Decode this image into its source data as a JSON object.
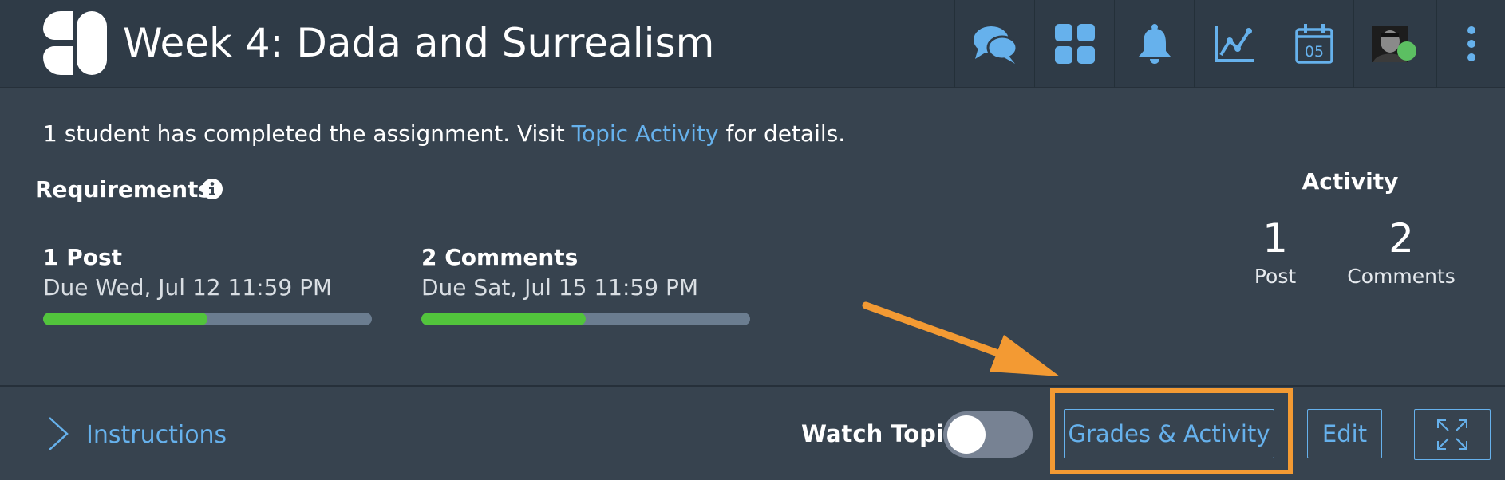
{
  "header": {
    "title": "Week 4: Dada and Surrealism",
    "logo_icon": "app-logo-icon",
    "nav": [
      {
        "name": "discussions-button",
        "icon": "chat-bubbles-icon"
      },
      {
        "name": "apps-button",
        "icon": "grid-icon"
      },
      {
        "name": "notifications-button",
        "icon": "bell-icon"
      },
      {
        "name": "analytics-button",
        "icon": "line-chart-icon"
      },
      {
        "name": "calendar-button",
        "icon": "calendar-icon",
        "day": "05"
      },
      {
        "name": "profile-button",
        "icon": "avatar-icon"
      },
      {
        "name": "more-button",
        "icon": "kebab-menu-icon"
      }
    ],
    "accent_color": "#66b1ec",
    "online_color": "#5cbf62"
  },
  "banner": {
    "prefix": "1 student has completed the assignment. Visit ",
    "link_text": "Topic Activity",
    "suffix": " for details."
  },
  "requirements": {
    "title": "Requirements",
    "info_icon": "info-circle-icon",
    "items": [
      {
        "name": "1 Post",
        "due": "Due Wed, Jul 12 11:59 PM",
        "progress": 0.5
      },
      {
        "name": "2 Comments",
        "due": "Due Sat, Jul 15 11:59 PM",
        "progress": 0.5
      }
    ],
    "progress_color": "#52c43c",
    "track_color": "#6b7d90"
  },
  "activity": {
    "title": "Activity",
    "stats": [
      {
        "value": "1",
        "label": "Post"
      },
      {
        "value": "2",
        "label": "Comments"
      }
    ]
  },
  "footer": {
    "instructions_label": "Instructions",
    "watch_topic_label": "Watch Topic",
    "watch_topic_on": false,
    "grades_button": "Grades & Activity",
    "edit_button": "Edit",
    "expand_icon": "expand-arrows-icon",
    "highlight_color": "#f39a33"
  }
}
